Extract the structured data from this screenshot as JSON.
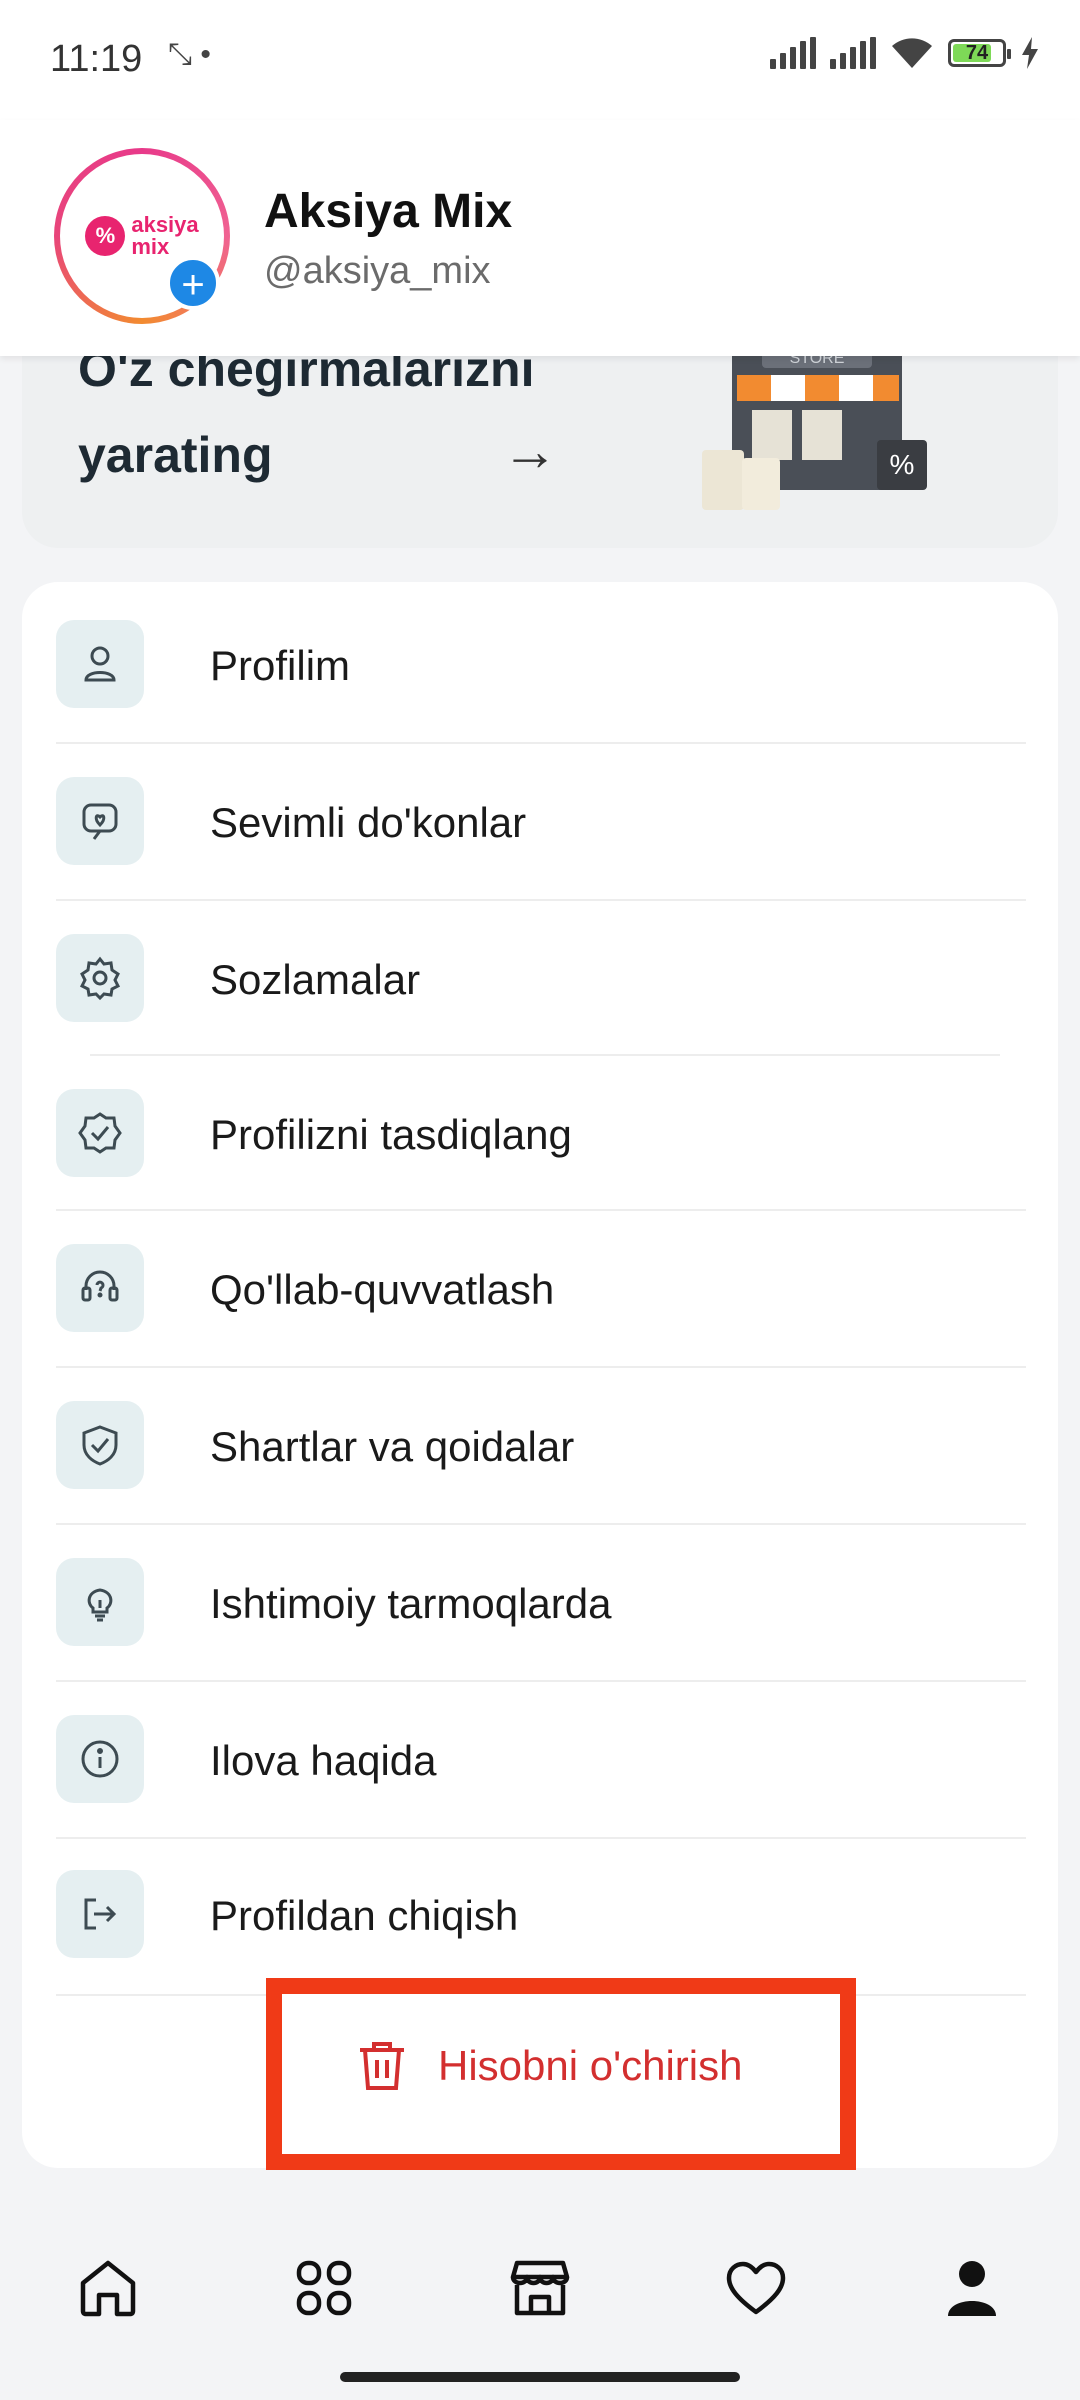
{
  "status_bar": {
    "time": "11:19",
    "extra": "⤡ •",
    "battery": "74"
  },
  "header": {
    "logo_line1": "aksiya",
    "logo_line2": "mix",
    "name": "Aksiya Mix",
    "handle": "@aksiya_mix"
  },
  "banner": {
    "line1": "O'z chegirmalarizni",
    "line2": "yarating",
    "store_sign": "STORE"
  },
  "menu": {
    "items": [
      {
        "label": "Profilim",
        "icon": "user-icon"
      },
      {
        "label": "Sevimli do'konlar",
        "icon": "favorite-shop-icon"
      },
      {
        "label": "Sozlamalar",
        "icon": "gear-icon"
      },
      {
        "label": "Profilizni tasdiqlang",
        "icon": "verified-badge-icon"
      },
      {
        "label": "Qo'llab-quvvatlash",
        "icon": "headset-icon"
      },
      {
        "label": "Shartlar va qoidalar",
        "icon": "shield-check-icon"
      },
      {
        "label": "Ishtimoiy tarmoqlarda",
        "icon": "lightbulb-icon"
      },
      {
        "label": "Ilova haqida",
        "icon": "info-icon"
      },
      {
        "label": "Profildan chiqish",
        "icon": "logout-icon"
      }
    ],
    "delete_label": "Hisobni o'chirish"
  },
  "bottom_nav": [
    "home-icon",
    "categories-icon",
    "store-icon",
    "heart-icon",
    "profile-icon"
  ],
  "colors": {
    "accent_red": "#d32f2f",
    "highlight_box": "#f03a17",
    "icon_bg": "#e5eff1",
    "brand_pink": "#e8246f"
  }
}
